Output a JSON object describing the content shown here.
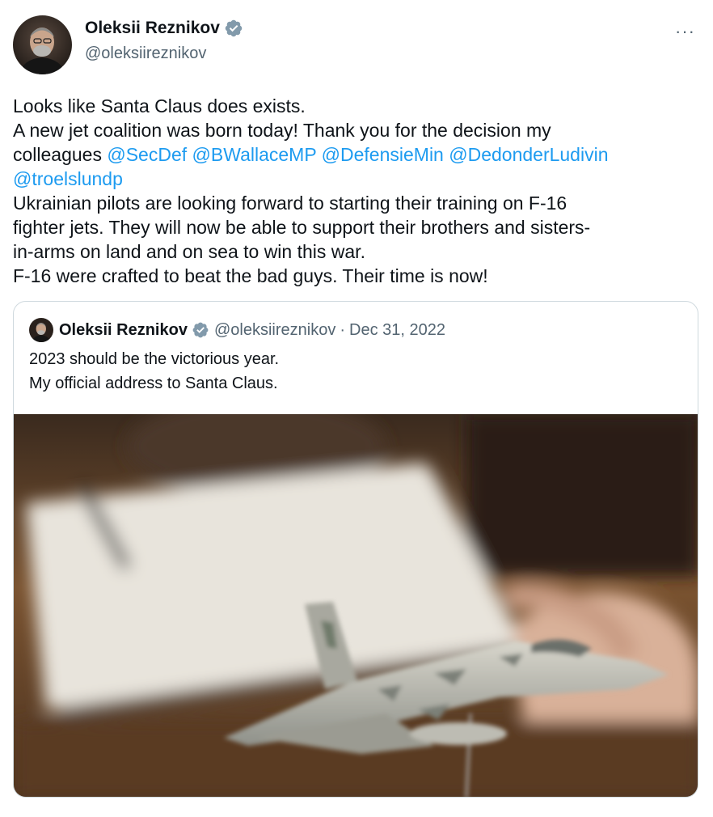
{
  "author": {
    "name": "Oleksii Reznikov",
    "handle": "@oleksiireznikov",
    "verified": true
  },
  "more_label": "···",
  "tweet": {
    "line1": "Looks like Santa Claus does exists.",
    "line2": "A new jet coalition was born today! Thank you for the decision my",
    "line3_prefix": "colleagues ",
    "mentions": [
      "@SecDef",
      "@BWallaceMP",
      "@DefensieMin",
      "@DedonderLudivin",
      "@troelslundp"
    ],
    "para2_l1": "Ukrainian pilots are looking forward to starting their training on F-16",
    "para2_l2": "fighter jets. They will now be able to support their brothers and sisters-",
    "para2_l3": "in-arms on land and on sea to win this war.",
    "para3": "F-16 were crafted to beat the bad guys. Their time is now!"
  },
  "quoted_tweet": {
    "name": "Oleksii Reznikov",
    "handle": "@oleksiireznikov",
    "separator": "·",
    "date": "Dec 31, 2022",
    "line1": "2023 should be the victorious year.",
    "line2": "My official address to Santa Claus."
  },
  "colors": {
    "link": "#1d9bf0",
    "verified": "#829aab",
    "secondary_text": "#536471",
    "border": "#cfd9de"
  },
  "icons": {
    "verified": "verified-badge-icon",
    "more": "more-options-icon"
  }
}
